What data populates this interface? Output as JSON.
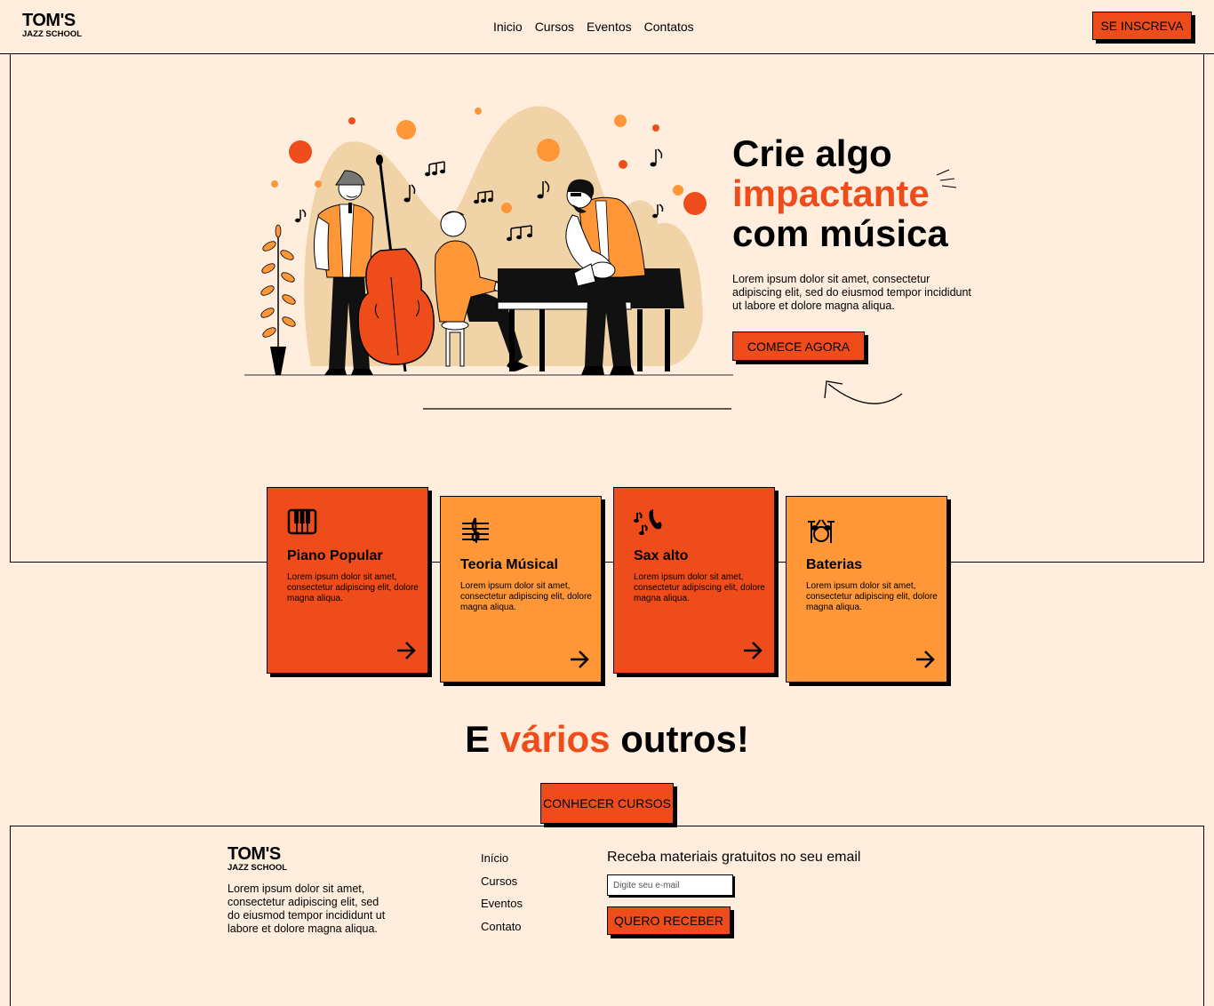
{
  "header": {
    "logo_line1": "TOM'S",
    "logo_line2": "JAZZ SCHOOL",
    "nav": [
      "Inicio",
      "Cursos",
      "Eventos",
      "Contatos"
    ],
    "signup_label": "SE INSCREVA"
  },
  "hero": {
    "title_line1": "Crie algo",
    "title_accent": "impactante",
    "title_line3": "com música",
    "text": "Lorem ipsum dolor sit amet, consectetur adipiscing elit, sed do eiusmod tempor incididunt ut labore et dolore magna aliqua.",
    "cta_label": "COMECE AGORA"
  },
  "cards": [
    {
      "title": "Piano Popular",
      "text": "Lorem ipsum dolor sit amet, consectetur adipiscing elit, dolore magna aliqua.",
      "icon": "piano-icon",
      "color": "#ee4d1b"
    },
    {
      "title": "Teoria Músical",
      "text": "Lorem ipsum dolor sit amet, consectetur adipiscing elit, dolore magna aliqua.",
      "icon": "music-staff-icon",
      "color": "#ff9637"
    },
    {
      "title": "Sax alto",
      "text": "Lorem ipsum dolor sit amet, consectetur adipiscing elit, dolore magna aliqua.",
      "icon": "saxophone-icon",
      "color": "#ee4d1b"
    },
    {
      "title": "Baterias",
      "text": "Lorem ipsum dolor sit amet, consectetur adipiscing elit, dolore magna aliqua.",
      "icon": "drums-icon",
      "color": "#ff9637"
    }
  ],
  "others": {
    "prefix": "E",
    "accent": "vários",
    "suffix": "outros!",
    "cta_label": "CONHECER CURSOS"
  },
  "footer": {
    "logo_line1": "TOM'S",
    "logo_line2": "JAZZ SCHOOL",
    "text": "Lorem ipsum dolor sit amet, consectetur adipiscing elit, sed do eiusmod tempor incididunt ut labore et dolore magna aliqua.",
    "links": [
      "Início",
      "Cursos",
      "Eventos",
      "Contato"
    ],
    "newsletter_title": "Receba materiais gratuitos no seu email",
    "email_placeholder": "Digite seu e-mail",
    "receive_label": "QUERO RECEBER"
  },
  "colors": {
    "background": "#ffeedd",
    "accent_red": "#ee4d1b",
    "accent_orange": "#ff9637",
    "blob": "#f1d3a8"
  }
}
